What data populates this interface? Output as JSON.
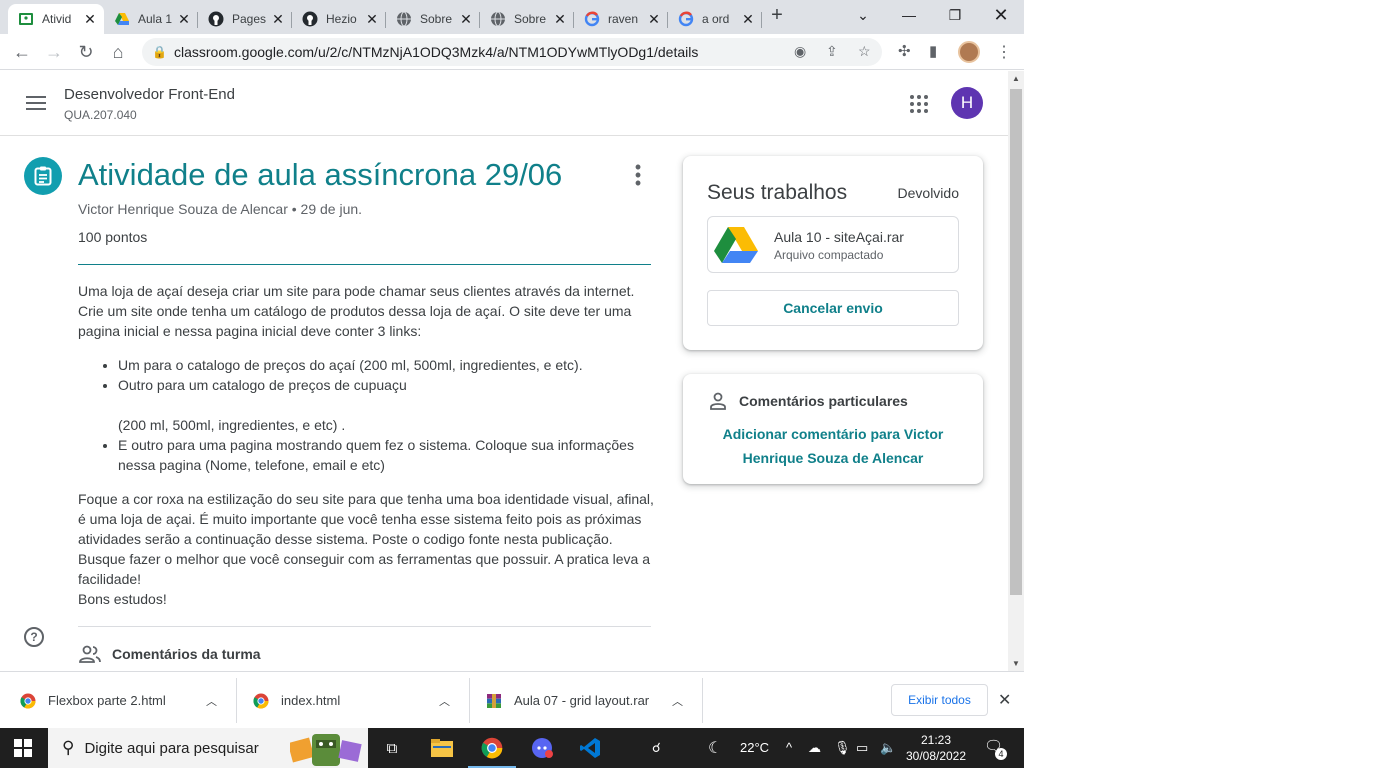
{
  "browser": {
    "tabs": [
      {
        "title": "Ativid",
        "icon": "classroom-icon",
        "active": true
      },
      {
        "title": "Aula 1",
        "icon": "drive-icon"
      },
      {
        "title": "Pages",
        "icon": "github-icon"
      },
      {
        "title": "Hezio",
        "icon": "github-icon"
      },
      {
        "title": "Sobre",
        "icon": "globe-icon"
      },
      {
        "title": "Sobre",
        "icon": "globe-icon"
      },
      {
        "title": "raven",
        "icon": "google-icon"
      },
      {
        "title": "a ord",
        "icon": "google-icon"
      }
    ],
    "url": "classroom.google.com/u/2/c/NTMzNjA1ODQ3Mzk4/a/NTM1ODYwMTlyODg1/details"
  },
  "header": {
    "course_title": "Desenvolvedor Front-End",
    "course_code": "QUA.207.040",
    "avatar_letter": "H"
  },
  "assignment": {
    "title": "Atividade de aula assíncrona 29/06",
    "meta": "Victor Henrique Souza de Alencar • 29 de jun.",
    "points": "100 pontos",
    "intro": "Uma loja de açaí deseja criar um site para pode chamar seus clientes através da internet. Crie um site onde tenha um catálogo de produtos dessa loja de açaí. O site deve ter uma pagina inicial e nessa pagina inicial deve conter 3 links:",
    "bullets": {
      "b1": "Um para o catalogo de preços do açaí (200 ml, 500ml, ingredientes, e etc).",
      "b2a": "Outro para um catalogo de preços de cupuaçu",
      "b2b": "(200 ml, 500ml, ingredientes, e etc)  .",
      "b3": "E outro para uma pagina mostrando quem fez o sistema. Coloque sua informações nessa pagina (Nome, telefone, email e etc)"
    },
    "closing": "Foque a cor roxa na estilização do seu site para que tenha uma boa identidade visual, afinal, é uma loja de açai. É muito importante que você tenha esse sistema feito pois as próximas atividades serão a continuação desse sistema. Poste o codigo fonte nesta publicação. Busque fazer o melhor que você conseguir com as ferramentas que possuir. A pratica leva a facilidade!",
    "signoff": "Bons estudos!",
    "class_comments": "Comentários da turma"
  },
  "work": {
    "heading": "Seus trabalhos",
    "status": "Devolvido",
    "file_name": "Aula 10 - siteAçai.rar",
    "file_type": "Arquivo compactado",
    "cancel_label": "Cancelar envio"
  },
  "private": {
    "heading": "Comentários particulares",
    "add_label": "Adicionar comentário para Victor Henrique Souza de Alencar"
  },
  "downloads": {
    "items": [
      {
        "name": "Flexbox parte 2.html"
      },
      {
        "name": "index.html"
      },
      {
        "name": "Aula 07 - grid layout.rar"
      }
    ],
    "show_all": "Exibir todos"
  },
  "taskbar": {
    "search_placeholder": "Digite aqui para pesquisar",
    "temperature": "22°C",
    "time": "21:23",
    "date": "30/08/2022",
    "notifications": "4"
  },
  "colors": {
    "teal": "#10808a",
    "avatar": "#5e35b1",
    "link_blue": "#1a73e8"
  }
}
